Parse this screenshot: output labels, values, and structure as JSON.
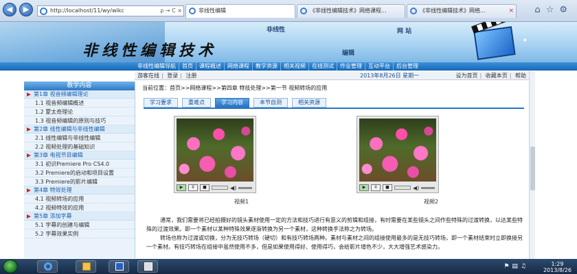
{
  "browser": {
    "address": "http://localhost/11/wy/wikc",
    "address_controls": "ρ → C ×",
    "tabs": [
      {
        "label": "非线性编辑"
      },
      {
        "label": "《非线性编辑技术》网络课程..."
      },
      {
        "label": "《非线性编辑技术》网络..."
      }
    ]
  },
  "banner": {
    "title": "非线性编辑技术",
    "small1": "非线性",
    "small2": "网  站",
    "small3": "编辑"
  },
  "nav": {
    "items": [
      "非线性编辑导航",
      "首页",
      "课程概述",
      "网络课程",
      "教学资源",
      "相关视频",
      "在线测试",
      "作业管理",
      "互动平台",
      "后台管理"
    ]
  },
  "subbar": {
    "visitor": "游客在线",
    "login": "登录",
    "register": "注册",
    "date": "2013年8月26日 星期一",
    "home": "设为首页",
    "favorite": "收藏本页",
    "help": "帮助"
  },
  "sidebar": {
    "title": "教学内容",
    "rows": [
      {
        "kind": "chap",
        "label": "第1章 视音频编辑理论"
      },
      {
        "kind": "sec",
        "label": "1.1 视音频编辑概述"
      },
      {
        "kind": "sec",
        "label": "1.2 蒙太奇理论"
      },
      {
        "kind": "sec",
        "label": "1.3 视音频编辑的原则与技巧"
      },
      {
        "kind": "chap",
        "label": "第2章 线性编辑与非线性编辑"
      },
      {
        "kind": "sec",
        "label": "2.1 线性编辑与非线性编辑"
      },
      {
        "kind": "sec",
        "label": "2.2 视频处理的基础知识"
      },
      {
        "kind": "chap",
        "label": "第3章 电视节目编辑"
      },
      {
        "kind": "sec",
        "label": "3.1 初识Premiere Pro CS4.0"
      },
      {
        "kind": "sec",
        "label": "3.2 Premiere的启动和项目设置"
      },
      {
        "kind": "sec",
        "label": "3.3 Premiere的影片编辑"
      },
      {
        "kind": "chap",
        "label": "第4章 特效处理"
      },
      {
        "kind": "sec",
        "label": "4.1 视频转场的应用"
      },
      {
        "kind": "sec",
        "label": "4.2 视频特效的应用"
      },
      {
        "kind": "chap",
        "label": "第5章 添加字幕"
      },
      {
        "kind": "sec",
        "label": "5.1 字幕的创建与编辑"
      },
      {
        "kind": "sec",
        "label": "5.2 字幕效果实例"
      }
    ]
  },
  "content": {
    "breadcrumb": "当前位置：首页>>网络课程>>第四章 特技处理>>第一节 视频转场的应用",
    "tabs": [
      "学习要求",
      "重难点",
      "学习内容",
      "本节自测",
      "相关资源"
    ],
    "active_tab": 2,
    "video1_caption": "视频1",
    "video2_caption": "视频2",
    "para1": "通常，我们需要将已经拍摄好的镜头素材使用一定的方法和技巧进行有意义的剪辑和组接，有时需要在某些镜头之间作些特殊的过渡转换，以达某些特殊的过渡效果。即一个素材以某种特殊效果逐渐转换为另一个素材，这种转换手法称之为转场。",
    "para2": "转场也称为过渡或切换，分为无技巧转场（硬切）和有技巧转场两种。素材与素材之间的组接使用最多的是无技巧转场，即一个素材结束时立即换接另一个素材。有技巧转场在组接中虽然使用不多，但是如果使用得好、使用得巧，会给影片增色不少，大大增强艺术感染力。"
  },
  "player": {
    "play": "▶",
    "pause": "II",
    "stop": "■",
    "volume": "◀)"
  },
  "taskbar": {
    "time": "1:29",
    "date": "2013/8/26"
  },
  "colors": {
    "nav_blue": "#1768b5",
    "active_tab": "#2a74c4",
    "sidebar_bg": "#eaf3fb",
    "chapter_text": "#1c5fb0"
  }
}
